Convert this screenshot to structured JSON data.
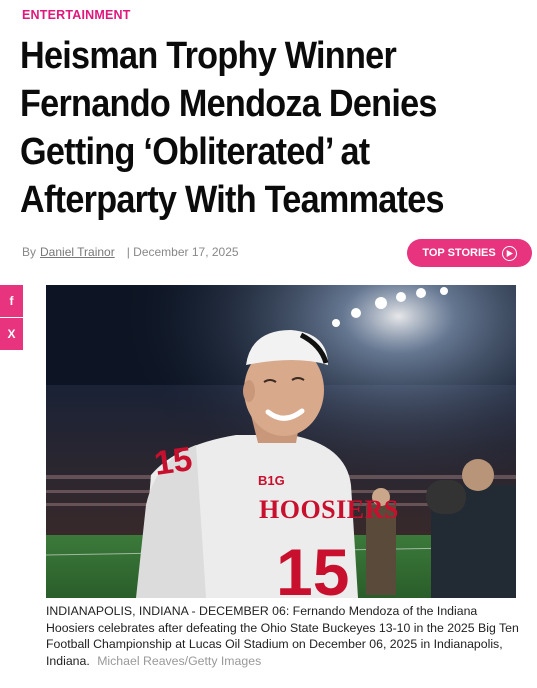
{
  "article": {
    "category": "ENTERTAINMENT",
    "headline": "Heisman Trophy Winner Fernando Mendoza Denies Getting ‘Obliterated’ at Afterparty With Teammates",
    "byline_prefix": "By",
    "author": "Daniel Trainor",
    "date": "| December 17, 2025"
  },
  "top_stories": {
    "label": "TOP STORIES",
    "icon": "play-circle-icon"
  },
  "share": {
    "facebook_label": "f",
    "x_label": "X"
  },
  "photo": {
    "jersey_team": "HOOSIERS",
    "jersey_number": "15",
    "league_logo": "B1G"
  },
  "caption": {
    "text": "INDIANAPOLIS, INDIANA - DECEMBER 06: Fernando Mendoza of the Indiana Hoosiers celebrates after defeating the Ohio State Buckeyes 13-10 in the 2025 Big Ten Football Championship at Lucas Oil Stadium on December 06, 2025 in Indianapolis, Indiana.",
    "credit": "Michael Reaves/Getty Images"
  },
  "colors": {
    "accent": "#e8347f",
    "category": "#e0177d",
    "jersey_red": "#c8102e"
  }
}
